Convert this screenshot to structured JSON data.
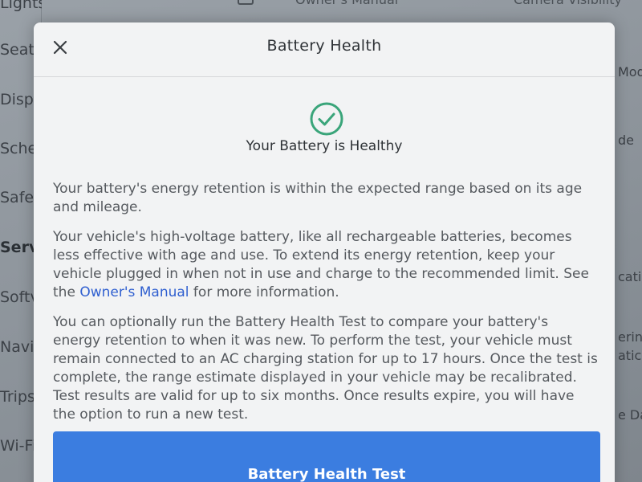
{
  "background": {
    "left_menu": [
      "Lights",
      "Seat",
      "Disp",
      "Sche",
      "Safe",
      "Serv",
      "Softv",
      "Navi",
      "Trips",
      "Wi-Fi"
    ],
    "left_menu_selected": "Serv",
    "top_items": [
      "Owner's Manual",
      "Camera Visibility"
    ],
    "right_items": [
      "Mode",
      "de",
      "cati",
      "erin",
      "atic",
      "e Da"
    ]
  },
  "modal": {
    "title": "Battery Health",
    "status_icon": "check-circle-icon",
    "status_heading": "Your Battery is Healthy",
    "paragraph_1": "Your battery's energy retention is within the expected range based on its age and mileage.",
    "paragraph_2_before_link": "Your vehicle's high-voltage battery, like all rechargeable batteries, becomes less effective with age and use. To extend its energy retention, keep your vehicle plugged in when not in use and charge to the recommended limit. See the ",
    "paragraph_2_link": "Owner's Manual",
    "paragraph_2_after_link": " for more information.",
    "paragraph_3": "You can optionally run the Battery Health Test to compare your battery's energy retention to when it was new. To perform the test, your vehicle must remain connected to an AC charging station for up to 17 hours. Once the test is complete, the range estimate displayed in your vehicle may be recalibrated. Test results are valid for up to six months. Once results expire, you will have the option to run a new test.",
    "primary_button": "Battery Health Test"
  },
  "colors": {
    "accent": "#3b7de0",
    "link": "#2f5fd0",
    "success": "#3aa57a"
  }
}
